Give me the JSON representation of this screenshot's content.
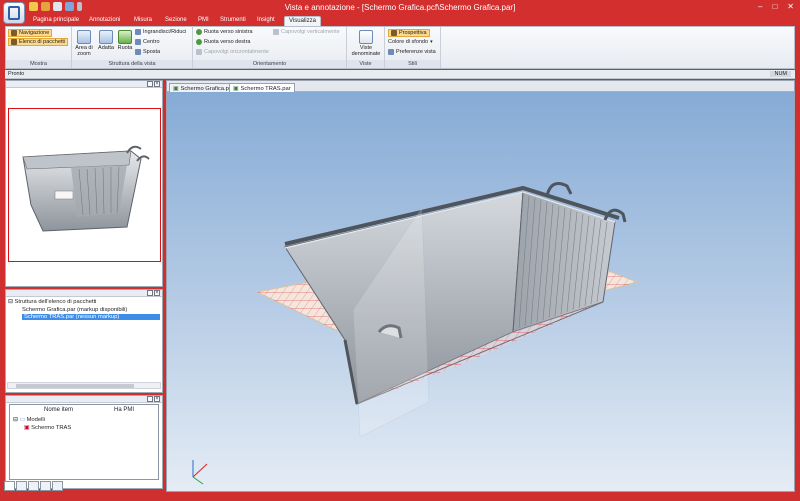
{
  "window": {
    "title": "Vista e annotazione - [Schermo Grafica.pcf\\Schermo Grafica.par]",
    "controls": [
      "–",
      "□",
      "✕"
    ]
  },
  "ribbon_tabs": [
    "Pagina principale",
    "Annotazioni",
    "Misura",
    "Sezione",
    "PMI",
    "Strumenti",
    "Insight",
    "Visualizza"
  ],
  "active_tab": "Visualizza",
  "ribbon": {
    "mostra": {
      "label": "Mostra",
      "navigazione": "Navigazione",
      "elenco_pacchetti": "Elenco di pacchetti"
    },
    "struttura": {
      "label": "Struttura della vista",
      "area_zoom_line1": "Area di",
      "area_zoom_line2": "zoom",
      "adatta": "Adatta",
      "ruota": "Ruota",
      "ingrandisci": "Ingrandisci/Riduci",
      "centro": "Centro",
      "sposta": "Sposta"
    },
    "orientamento": {
      "label": "Orientamento",
      "ruota_sinistra": "Ruota verso sinistra",
      "ruota_destra": "Ruota verso destra",
      "capovolgi_orizz": "Capovolgi orizzontalmente",
      "capovolgi_vert": "Capovolgi verticalmente"
    },
    "viste": {
      "label": "Viste",
      "viste_denominate_line1": "Viste",
      "viste_denominate_line2": "denominate"
    },
    "stili": {
      "label": "Stili",
      "prospettiva": "Prospettiva",
      "colore_sfondo": "Colore di sfondo",
      "preferenze_vista": "Preferenze vista"
    }
  },
  "status": {
    "left": "Pronto",
    "right": "NUM"
  },
  "package_tree": {
    "root": "Struttura dell'elenco di pacchetti",
    "items": [
      "Schermo Grafica.par (markup disponibili)",
      "Schermo TRAS.par (nessun markup)"
    ],
    "selected_index": 1
  },
  "models_panel": {
    "col_name": "Nome item",
    "col_pmi": "Ha PMI",
    "rows": [
      "Modelli",
      "Schermo TRAS"
    ]
  },
  "doc_tabs": [
    "Schermo Grafica.par",
    "Schermo TRAS.par"
  ],
  "active_doc_tab": 1,
  "colors": {
    "titlebar": "#d32f2f",
    "highlight": "#fbd88b",
    "selection": "#3d8ee8",
    "grid_red": "#e0303a"
  }
}
